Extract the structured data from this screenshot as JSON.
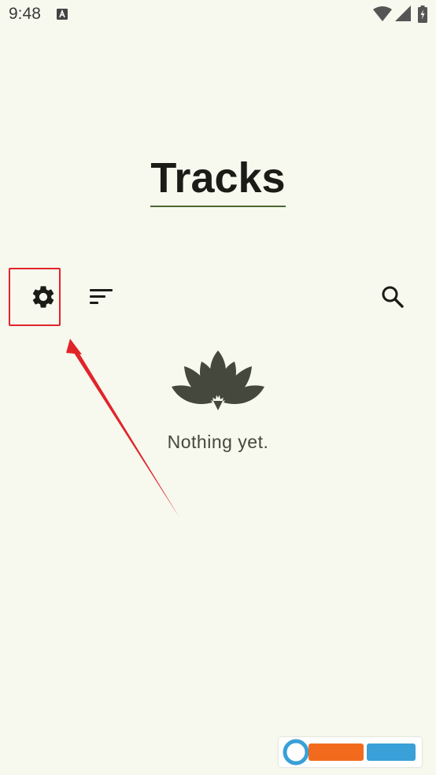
{
  "status_bar": {
    "time": "9:48",
    "icons": [
      "notification-a-icon",
      "wifi-icon",
      "signal-icon",
      "battery-charging-icon"
    ]
  },
  "header": {
    "title": "Tracks"
  },
  "toolbar": {
    "settings_icon": "gear-icon",
    "sort_icon": "sort-icon",
    "search_icon": "search-icon"
  },
  "empty_state": {
    "icon": "lotus-icon",
    "message": "Nothing yet."
  },
  "annotation": {
    "color": "#e0252a"
  },
  "colors": {
    "background": "#f7f8ee",
    "title_underline": "#4c6634",
    "text": "#1b1c16",
    "muted_text": "#45483d"
  }
}
